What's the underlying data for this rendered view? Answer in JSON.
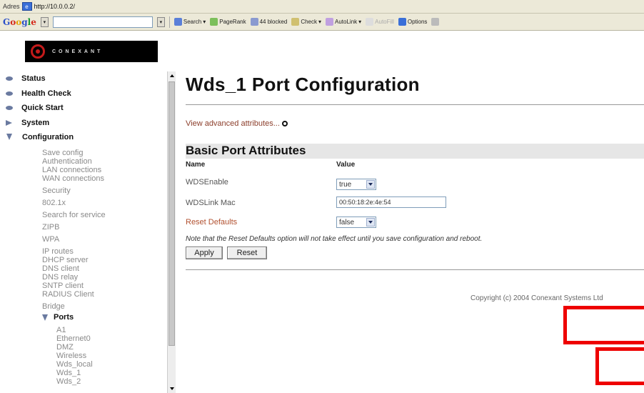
{
  "browser": {
    "address_label": "Adres",
    "url": "http://10.0.0.2/",
    "toolbar": {
      "google_letters": [
        "G",
        "o",
        "o",
        "g",
        "l",
        "e"
      ],
      "search_label": "Search",
      "pagerank_label": "PageRank",
      "blocked_label": "44 blocked",
      "check_label": "Check",
      "autolink_label": "AutoLink",
      "autofill_label": "AutoFill",
      "options_label": "Options"
    }
  },
  "header": {
    "logo_text": "CONEXANT"
  },
  "sidebar": {
    "top_items": [
      {
        "label": "Status",
        "icon": "bullet-icon"
      },
      {
        "label": "Health Check",
        "icon": "bullet-icon"
      },
      {
        "label": "Quick Start",
        "icon": "bullet-icon"
      },
      {
        "label": "System",
        "icon": "arrow-right-icon"
      },
      {
        "label": "Configuration",
        "icon": "arrow-down-icon"
      }
    ],
    "config_items": [
      "Save config",
      "Authentication",
      "LAN connections",
      "WAN connections",
      "Security",
      "802.1x",
      "Search for service",
      "ZIPB",
      "WPA",
      "IP routes",
      "DHCP server",
      "DNS client",
      "DNS relay",
      "SNTP client",
      "RADIUS Client",
      "Bridge"
    ],
    "ports_label": "Ports",
    "port_items": [
      "A1",
      "Ethernet0",
      "DMZ",
      "Wireless",
      "Wds_local",
      "Wds_1",
      "Wds_2"
    ]
  },
  "main": {
    "title": "Wds_1 Port Configuration",
    "advanced_link": "View advanced attributes...",
    "section_title": "Basic Port Attributes",
    "col_name": "Name",
    "col_value": "Value",
    "rows": [
      {
        "label": "WDSEnable",
        "value": "true"
      },
      {
        "label": "WDSLink Mac",
        "value": "00:50:18:2e:4e:54"
      },
      {
        "label": "Reset Defaults",
        "value": "false"
      }
    ],
    "note": "Note that the Reset Defaults option will not take effect until you save configuration and reboot.",
    "apply_label": "Apply",
    "reset_label": "Reset",
    "copyright": "Copyright (c) 2004 Conexant Systems Ltd"
  },
  "colors": {
    "annotation_red": "#ee0000",
    "nav_icon": "#6a7aa0",
    "link": "#8b3d2a"
  }
}
